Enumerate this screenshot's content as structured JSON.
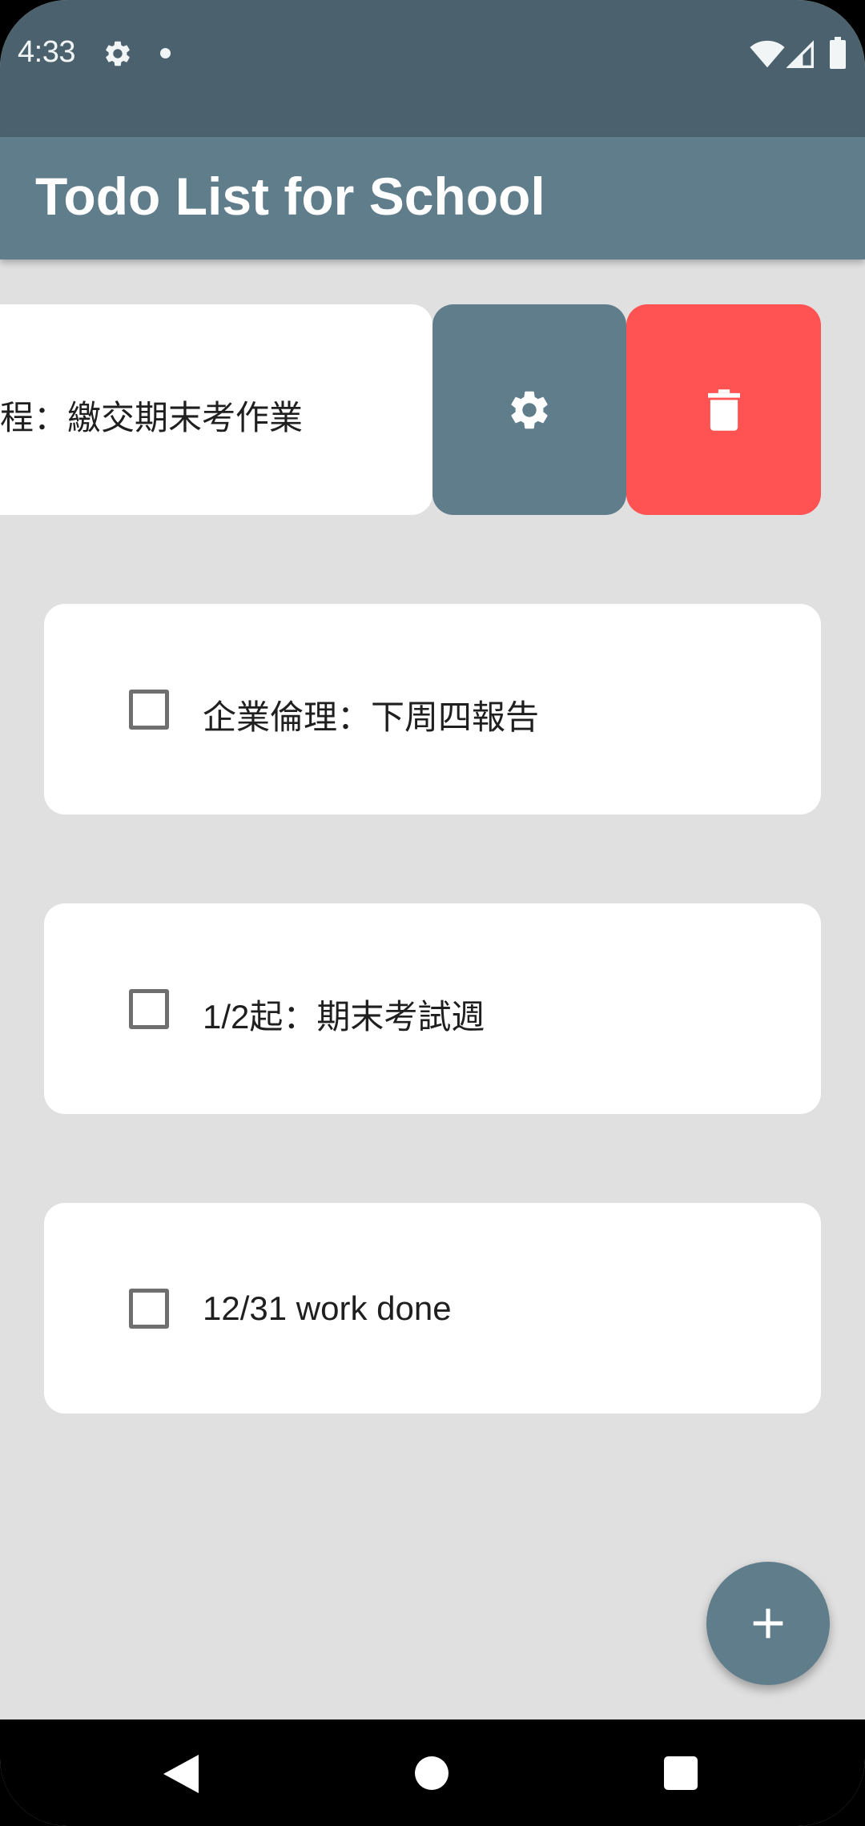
{
  "status_bar": {
    "time": "4:33",
    "icons": [
      "gear-icon",
      "notification-dot-icon",
      "wifi-icon",
      "signal-icon",
      "battery-icon"
    ]
  },
  "app_bar": {
    "title": "Todo List for School"
  },
  "todos": [
    {
      "text": "程：繳交期末考作業",
      "checked": false,
      "swiped_open": true
    },
    {
      "text": "企業倫理：下周四報告",
      "checked": false
    },
    {
      "text": "1/2起：期末考試週",
      "checked": false
    },
    {
      "text": "12/31 work done",
      "checked": false
    }
  ],
  "swipe_actions": {
    "edit_icon": "gear-icon",
    "delete_icon": "trash-icon"
  },
  "fab": {
    "icon": "plus-icon"
  },
  "nav_bar": {
    "icons": [
      "back-icon",
      "home-icon",
      "recents-icon"
    ]
  },
  "colors": {
    "status_bar": "#4b626e",
    "app_bar": "#607d8b",
    "background": "#e0e0e0",
    "delete": "#ff5252",
    "edit": "#607d8b",
    "fab": "#607d8b"
  }
}
